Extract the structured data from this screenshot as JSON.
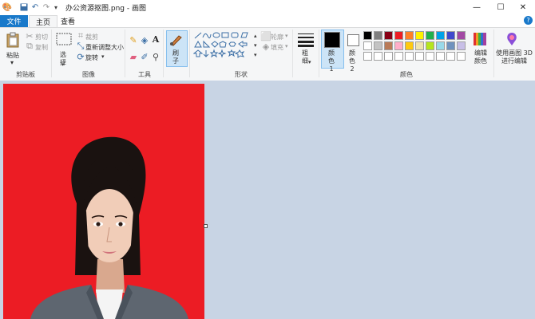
{
  "titlebar": {
    "filename": "办公资源抠图.png",
    "separator": "-",
    "app_name": "画图"
  },
  "tabs": {
    "file": "文件",
    "home": "主页",
    "view": "查看"
  },
  "clipboard": {
    "paste": "粘贴",
    "cut": "剪切",
    "copy": "复制",
    "group": "剪贴板"
  },
  "image": {
    "select": "选择",
    "crop": "裁剪",
    "resize": "重新调整大小",
    "rotate": "旋转",
    "group": "图像"
  },
  "tools": {
    "group": "工具"
  },
  "brushes": {
    "label": "刷子"
  },
  "shapes": {
    "outline": "轮廓",
    "fill": "填充",
    "group": "形状"
  },
  "size": {
    "label": "粗细"
  },
  "colors": {
    "color1": "颜色 1",
    "color2": "颜色 2",
    "edit": "编辑颜色",
    "group": "颜色",
    "color1_value": "#000000",
    "color2_value": "#ffffff",
    "palette_row1": [
      "#000000",
      "#7f7f7f",
      "#880015",
      "#ed1c24",
      "#ff7f27",
      "#fff200",
      "#22b14c",
      "#00a2e8",
      "#3f48cc",
      "#a349a4"
    ],
    "palette_row2": [
      "#ffffff",
      "#c3c3c3",
      "#b97a57",
      "#ffaec9",
      "#ffc90e",
      "#efe4b0",
      "#b5e61d",
      "#99d9ea",
      "#7092be",
      "#c8bfe7"
    ],
    "palette_row3": [
      "#ffffff",
      "#ffffff",
      "#ffffff",
      "#ffffff",
      "#ffffff",
      "#ffffff",
      "#ffffff",
      "#ffffff",
      "#ffffff",
      "#ffffff"
    ]
  },
  "paint3d": {
    "label": "使用画图 3D 进行编辑"
  },
  "canvas": {
    "background": "#ec1c24",
    "workspace": "#c8d4e4"
  }
}
